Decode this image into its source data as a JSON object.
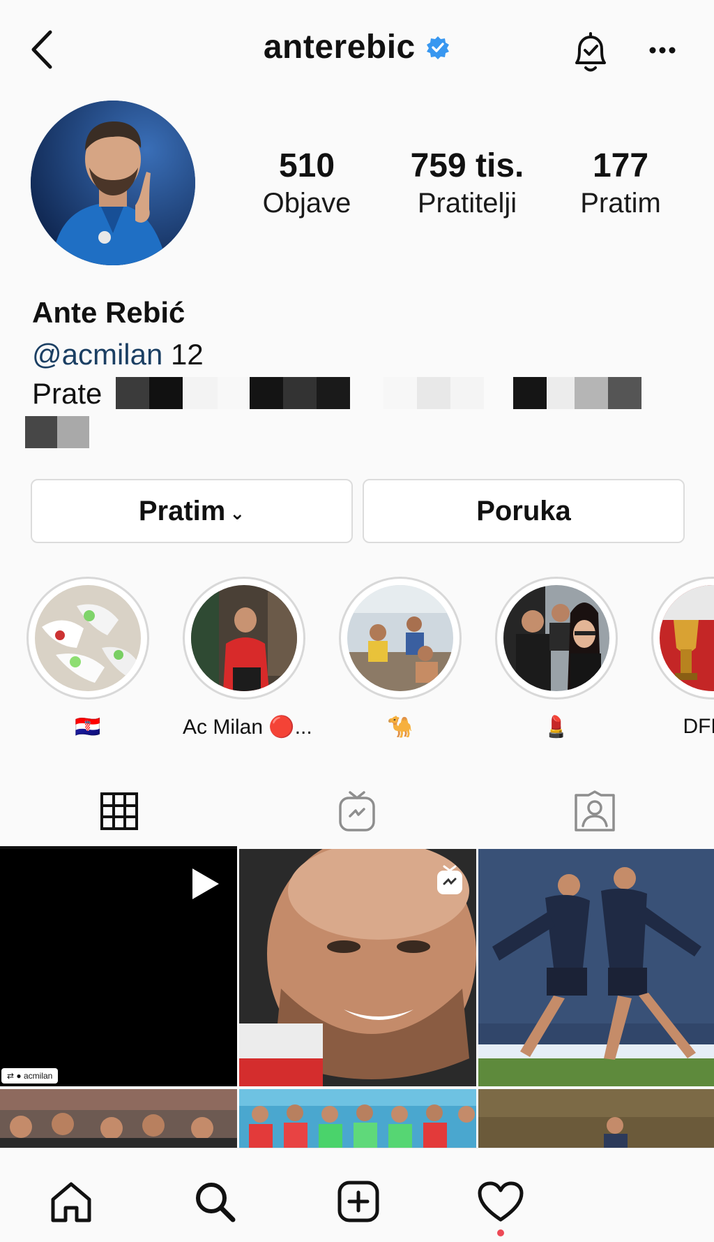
{
  "header": {
    "username": "anterebic",
    "verified": true
  },
  "profile": {
    "stats": {
      "posts_count": "510",
      "posts_label": "Objave",
      "followers_count": "759 tis.",
      "followers_label": "Pratitelji",
      "following_count": "177",
      "following_label": "Pratim"
    },
    "name": "Ante Rebić",
    "bio_link": "@acmilan",
    "bio_rest": " 12",
    "followed_by_prefix": "Prate"
  },
  "buttons": {
    "follow_label": "Pratim",
    "message_label": "Poruka"
  },
  "highlights": [
    {
      "label": "🇭🇷"
    },
    {
      "label": "Ac Milan 🔴..."
    },
    {
      "label": "🐪"
    },
    {
      "label": "💄"
    },
    {
      "label": "DFB p"
    }
  ],
  "tabs": [
    "grid-icon",
    "igtv-icon",
    "tagged-icon"
  ],
  "grid": {
    "first_post_tag": "acmilan"
  },
  "colors": {
    "link": "#1b3f63",
    "verified": "#3897f0",
    "notification": "#ed4956"
  },
  "nav": [
    "home-icon",
    "search-icon",
    "new-post-icon",
    "activity-icon"
  ]
}
